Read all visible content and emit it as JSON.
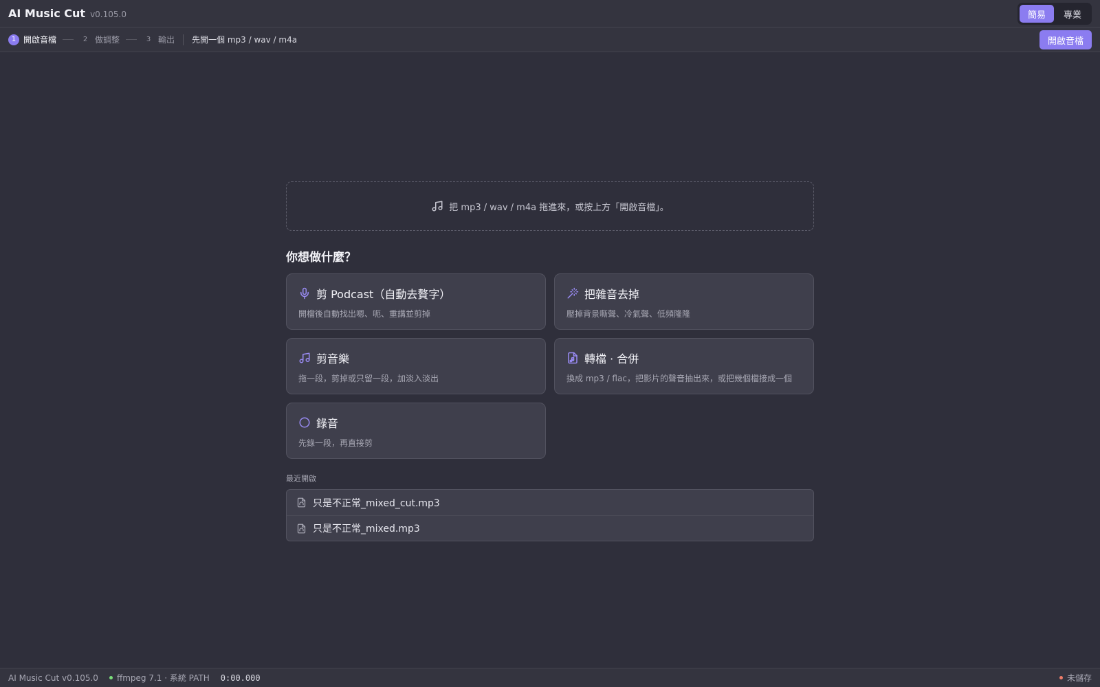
{
  "app": {
    "title": "AI Music Cut",
    "version": "v0.105.0"
  },
  "mode": {
    "simple": "簡易",
    "pro": "專業",
    "active": "simple"
  },
  "steps": [
    {
      "num": "1",
      "label": "開啟音檔"
    },
    {
      "num": "2",
      "label": "做調整"
    },
    {
      "num": "3",
      "label": "輸出"
    }
  ],
  "step_hint": "先開一個 mp3 / wav / m4a",
  "open_button": "開啟音檔",
  "dropzone": {
    "icon": "music-note-icon",
    "text": "把 mp3 / wav / m4a 拖進來，或按上方「開啟音檔」。"
  },
  "section_title": "你想做什麼？",
  "actions": [
    {
      "icon": "microphone-icon",
      "title": "剪 Podcast（自動去贅字）",
      "desc": "開檔後自動找出嗯、呃、重講並剪掉"
    },
    {
      "icon": "magic-wand-icon",
      "title": "把雜音去掉",
      "desc": "壓掉背景嘶聲、冷氣聲、低頻隆隆"
    },
    {
      "icon": "music-note-icon",
      "title": "剪音樂",
      "desc": "拖一段，剪掉或只留一段，加淡入淡出"
    },
    {
      "icon": "file-audio-icon",
      "title": "轉檔 · 合併",
      "desc": "換成 mp3 / flac，把影片的聲音抽出來，或把幾個檔接成一個"
    },
    {
      "icon": "record-circle-icon",
      "title": "錄音",
      "desc": "先錄一段，再直接剪"
    }
  ],
  "recent": {
    "label": "最近開啟",
    "files": [
      "只是不正常_mixed_cut.mp3",
      "只是不正常_mixed.mp3"
    ]
  },
  "status": {
    "version": "AI Music Cut v0.105.0",
    "ffmpeg": "ffmpeg 7.1 · 系統 PATH",
    "time": "0:00.000",
    "save": "未儲存"
  },
  "colors": {
    "accent": "#8b7cf0",
    "background": "#2f2f3b",
    "ok": "#7be07b",
    "unsaved": "#ef7d6a"
  }
}
